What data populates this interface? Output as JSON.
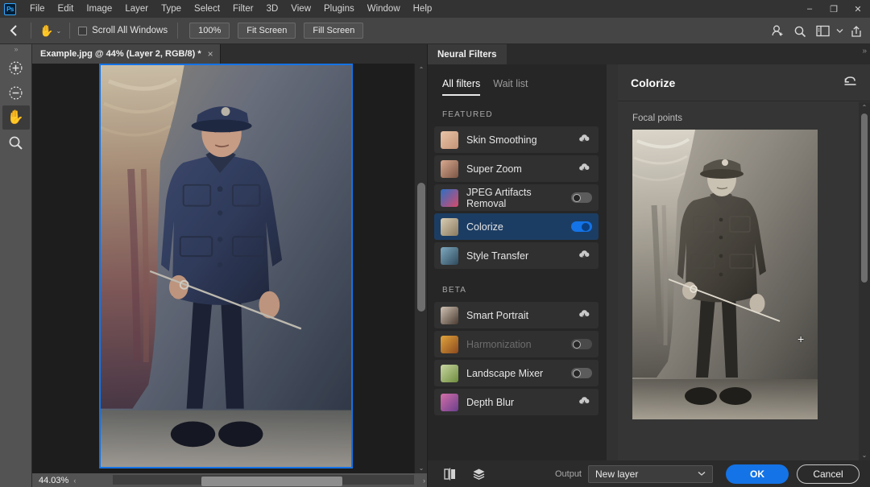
{
  "app": {
    "logo_text": "Ps",
    "menus": [
      "File",
      "Edit",
      "Image",
      "Layer",
      "Type",
      "Select",
      "Filter",
      "3D",
      "View",
      "Plugins",
      "Window",
      "Help"
    ],
    "window_controls": {
      "minimize": "–",
      "restore": "❐",
      "close": "✕"
    },
    "accent_color": "#1473e6",
    "selection_border_color": "#1473e6"
  },
  "options_bar": {
    "back_icon": "chevron-left-icon",
    "tool_icon": "hand-tool-icon",
    "tool_caret": "⌄",
    "scroll_all_windows_label": "Scroll All Windows",
    "scroll_all_windows_checked": false,
    "buttons": [
      "100%",
      "Fit Screen",
      "Fill Screen"
    ],
    "right_icons": [
      "share-user-icon",
      "search-icon",
      "workspace-icon",
      "chevron-down-icon",
      "export-icon"
    ]
  },
  "toolbar": {
    "grip": "»",
    "tools": [
      {
        "name": "zoom-in-tool",
        "glyph": "+",
        "active": false
      },
      {
        "name": "zoom-out-tool",
        "glyph": "−",
        "active": false
      },
      {
        "name": "hand-tool",
        "glyph": "✋",
        "active": true
      },
      {
        "name": "magnifier-tool",
        "glyph": "⚲",
        "active": false
      }
    ]
  },
  "document": {
    "tab_label": "Example.jpg @ 44% (Layer 2, RGB/8) *",
    "tab_close": "×",
    "zoom_level": "44.03%",
    "scroll_left_arrow": "‹",
    "scroll_right_arrow": "›",
    "scroll_up_arrow": "⌃",
    "scroll_down_arrow": "⌄"
  },
  "neural_filters": {
    "panel_tab": "Neural Filters",
    "panel_grip": "»",
    "subtabs": [
      {
        "label": "All filters",
        "active": true
      },
      {
        "label": "Wait list",
        "active": false
      }
    ],
    "sections": [
      {
        "heading": "FEATURED",
        "filters": [
          {
            "name": "Skin Smoothing",
            "control": "cloud",
            "selected": false,
            "enabled": true,
            "thumb_colors": [
              "#e8c4a8",
              "#c49376"
            ]
          },
          {
            "name": "Super Zoom",
            "control": "cloud",
            "selected": false,
            "enabled": true,
            "thumb_colors": [
              "#d9a98f",
              "#7a5544"
            ]
          },
          {
            "name": "JPEG Artifacts Removal",
            "control": "toggle-off",
            "selected": false,
            "enabled": true,
            "thumb_colors": [
              "#2d6fc4",
              "#d64a6b"
            ]
          },
          {
            "name": "Colorize",
            "control": "toggle-on",
            "selected": true,
            "enabled": true,
            "thumb_colors": [
              "#d8cdb4",
              "#8a7a5e"
            ]
          },
          {
            "name": "Style Transfer",
            "control": "cloud",
            "selected": false,
            "enabled": true,
            "thumb_colors": [
              "#7ea9c0",
              "#2f4a5c"
            ]
          }
        ]
      },
      {
        "heading": "BETA",
        "filters": [
          {
            "name": "Smart Portrait",
            "control": "cloud",
            "selected": false,
            "enabled": true,
            "thumb_colors": [
              "#cfc2b4",
              "#4a3a30"
            ]
          },
          {
            "name": "Harmonization",
            "control": "toggle-off",
            "selected": false,
            "enabled": false,
            "thumb_colors": [
              "#e0a43c",
              "#8c4a1e"
            ]
          },
          {
            "name": "Landscape Mixer",
            "control": "toggle-off",
            "selected": false,
            "enabled": true,
            "thumb_colors": [
              "#c9d7a2",
              "#6e8c3d"
            ]
          },
          {
            "name": "Depth Blur",
            "control": "cloud",
            "selected": false,
            "enabled": true,
            "thumb_colors": [
              "#d46ea8",
              "#6a3f8c"
            ]
          }
        ]
      }
    ],
    "cloud_glyph": "☁",
    "detail": {
      "title": "Colorize",
      "reset_icon": "undo-reset-icon",
      "focal_points_label": "Focal points",
      "focal_marker": "+"
    },
    "footer": {
      "preview_compare_icon": "split-preview-icon",
      "layers_icon": "layers-icon",
      "output_label": "Output",
      "output_value": "New layer",
      "output_chevron": "⌄",
      "ok_label": "OK",
      "cancel_label": "Cancel"
    }
  }
}
